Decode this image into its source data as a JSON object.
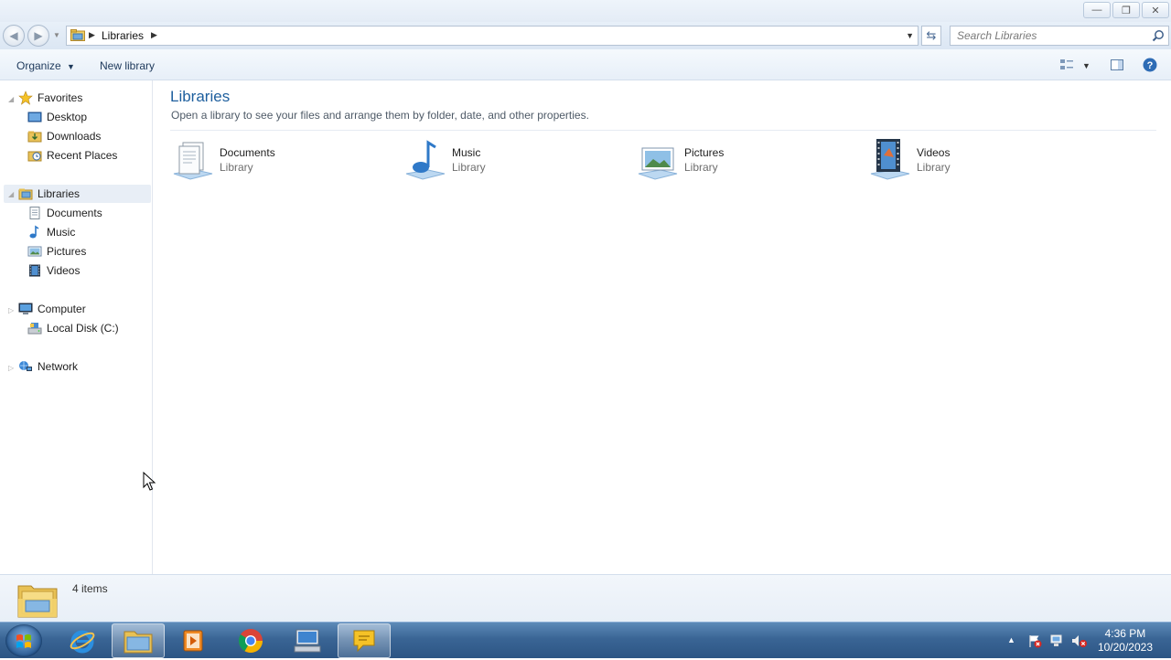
{
  "window": {
    "controls": [
      "minimize",
      "restore",
      "close"
    ]
  },
  "address": {
    "breadcrumb": "Libraries",
    "search_placeholder": "Search Libraries"
  },
  "toolbar": {
    "organize_label": "Organize",
    "new_library_label": "New library"
  },
  "sidebar": {
    "favorites": {
      "label": "Favorites",
      "items": [
        "Desktop",
        "Downloads",
        "Recent Places"
      ]
    },
    "libraries": {
      "label": "Libraries",
      "items": [
        "Documents",
        "Music",
        "Pictures",
        "Videos"
      ]
    },
    "computer": {
      "label": "Computer",
      "items": [
        "Local Disk (C:)"
      ]
    },
    "network": {
      "label": "Network"
    }
  },
  "content": {
    "title": "Libraries",
    "subtitle": "Open a library to see your files and arrange them by folder, date, and other properties.",
    "libraries": [
      {
        "name": "Documents",
        "type": "Library",
        "icon": "documents-library-icon"
      },
      {
        "name": "Music",
        "type": "Library",
        "icon": "music-library-icon"
      },
      {
        "name": "Pictures",
        "type": "Library",
        "icon": "pictures-library-icon"
      },
      {
        "name": "Videos",
        "type": "Library",
        "icon": "videos-library-icon"
      }
    ]
  },
  "details": {
    "count": "4 items"
  },
  "taskbar": {
    "apps": [
      "internet-explorer-icon",
      "windows-explorer-icon",
      "media-player-icon",
      "chrome-icon",
      "remote-desktop-icon",
      "speech-bubble-icon"
    ],
    "clock_time": "4:36 PM",
    "clock_date": "10/20/2023"
  },
  "colors": {
    "title_accent": "#1e5f9e",
    "taskbar": "#3a6595"
  }
}
